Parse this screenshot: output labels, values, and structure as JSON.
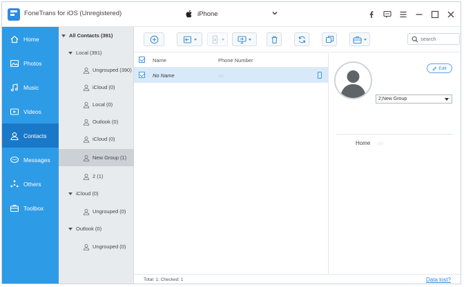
{
  "app": {
    "title": "FoneTrans for iOS (Unregistered)",
    "device": "iPhone"
  },
  "sidebar": {
    "items": [
      {
        "label": "Home",
        "icon": "home-icon"
      },
      {
        "label": "Photos",
        "icon": "photos-icon"
      },
      {
        "label": "Music",
        "icon": "music-icon"
      },
      {
        "label": "Videos",
        "icon": "videos-icon"
      },
      {
        "label": "Contacts",
        "icon": "contacts-icon",
        "active": true
      },
      {
        "label": "Messages",
        "icon": "messages-icon"
      },
      {
        "label": "Others",
        "icon": "others-icon"
      },
      {
        "label": "Toolbox",
        "icon": "toolbox-icon"
      }
    ]
  },
  "tree": {
    "root": "All Contacts (391)",
    "rows": [
      {
        "label": "Local (391)",
        "type": "folder"
      },
      {
        "label": "Ungrouped (390)",
        "type": "group"
      },
      {
        "label": "iCloud (0)",
        "type": "group"
      },
      {
        "label": "Local (0)",
        "type": "group"
      },
      {
        "label": "Outlook (0)",
        "type": "group"
      },
      {
        "label": "iCloud (0)",
        "type": "group"
      },
      {
        "label": "New Group (1)",
        "type": "group",
        "selected": true
      },
      {
        "label": "2 (1)",
        "type": "group"
      },
      {
        "label": "iCloud (0)",
        "type": "folder"
      },
      {
        "label": "Ungrouped (0)",
        "type": "group"
      },
      {
        "label": "Outlook (0)",
        "type": "folder"
      },
      {
        "label": "Ungrouped (0)",
        "type": "group"
      }
    ]
  },
  "toolbar": {
    "search_placeholder": "search"
  },
  "list": {
    "headers": {
      "name": "Name",
      "phone": "Phone Number"
    },
    "rows": [
      {
        "name": "No Name",
        "phone": "—"
      }
    ]
  },
  "detail": {
    "edit_label": "Edit",
    "group_value": "2;New Group",
    "home_label": "Home",
    "home_value": "—"
  },
  "status": {
    "text": "Total: 1; Checked: 1",
    "data_lost": "Data lost?"
  },
  "colors": {
    "sidebar": "#2e9be6",
    "sidebar_active": "#1a78c8",
    "accent": "#2e88d8",
    "row_selected": "#d8eaf9"
  }
}
